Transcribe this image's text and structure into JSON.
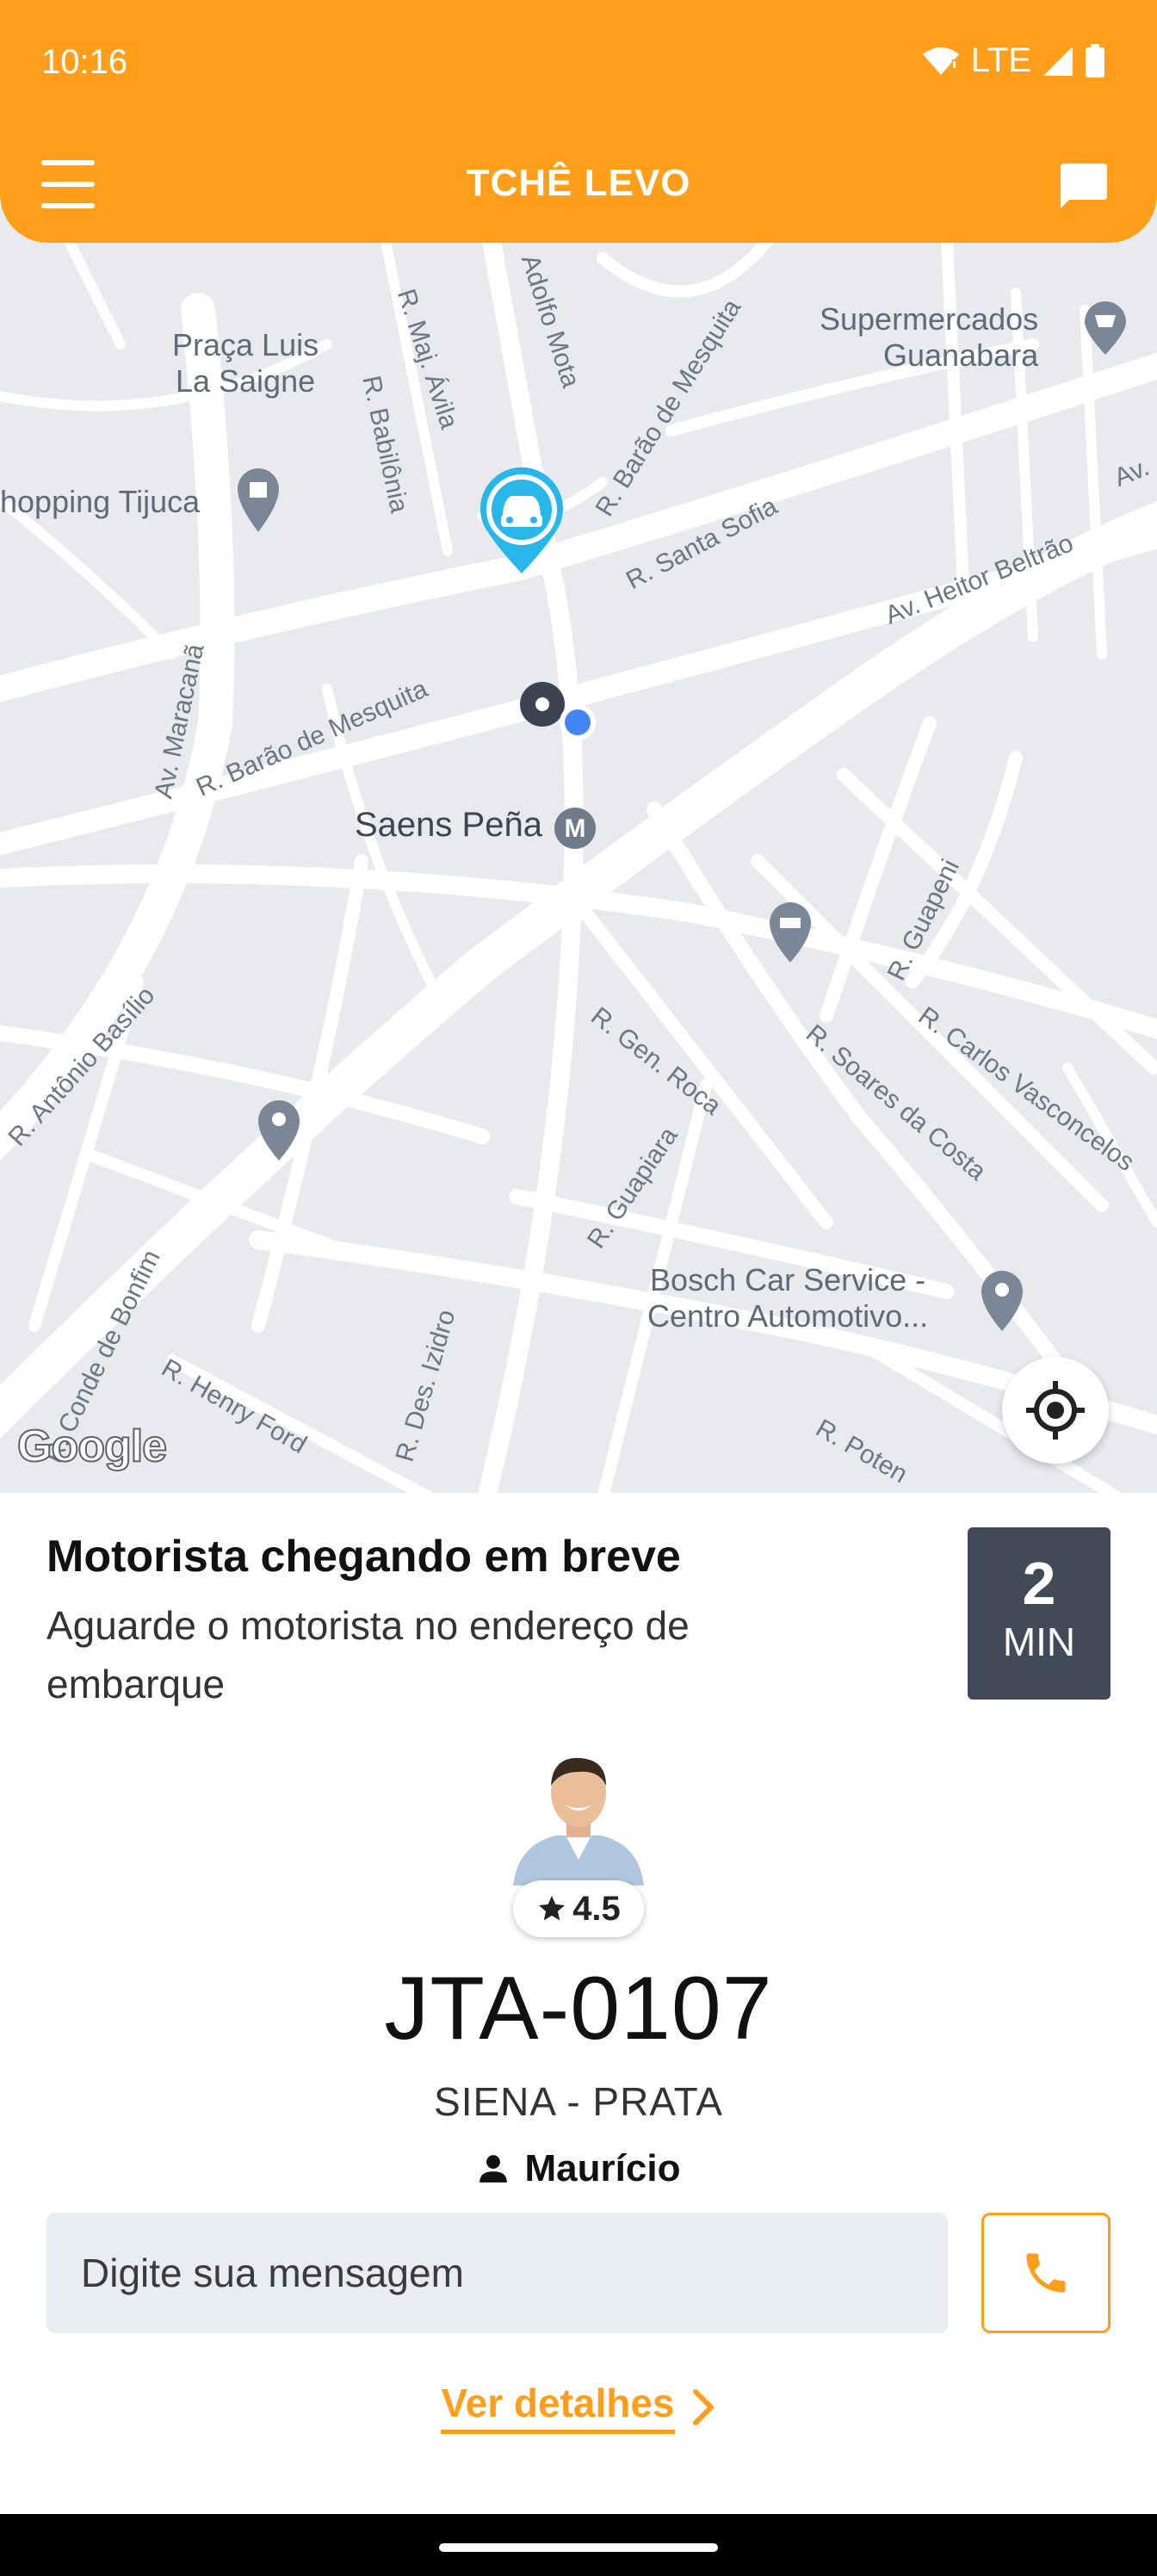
{
  "status_bar": {
    "time": "10:16",
    "network": "LTE"
  },
  "header": {
    "title": "TCHÊ LEVO",
    "menu_icon": "hamburger-menu-icon",
    "chat_icon": "chat-bubble-icon",
    "background_color": "#FF9E1B"
  },
  "map": {
    "places": [
      {
        "name": "Praça Luis",
        "line2": "La Saigne"
      },
      {
        "name": "Supermercados",
        "line2": "Guanabara"
      },
      {
        "name": "hopping Tijuca"
      },
      {
        "name": "Saens Peña"
      },
      {
        "name": "Bosch Car Service -",
        "line2": "Centro Automotivo..."
      }
    ],
    "streets": [
      "R. Maj. Ávila",
      "R. Babilônia",
      "Adolfo Mota",
      "R. Barão de Mesquita",
      "R. Santa Sofia",
      "Av. Heitor Beltrão",
      "Av. Maracanã",
      "R. Barão de Mesquita",
      "R. Guapeni",
      "R. Antônio Basílio",
      "R. Gen. Roca",
      "R. Soares da Costa",
      "R. Carlos Vasconcelos",
      "R. Guapiara",
      "R. Conde de Bonfim",
      "R. Henry Ford",
      "R. Des. Izidro",
      "R. Poten",
      "Av."
    ],
    "attribution": "Google"
  },
  "trip": {
    "title": "Motorista chegando em breve",
    "subtitle": "Aguarde o motorista no endereço de embarque",
    "eta_value": "2",
    "eta_unit": "MIN"
  },
  "driver": {
    "rating": "4.5",
    "plate": "JTA-0107",
    "car": "SIENA - PRATA",
    "name": "Maurício"
  },
  "message": {
    "placeholder": "Digite sua mensagem"
  },
  "details_link": "Ver detalhes"
}
